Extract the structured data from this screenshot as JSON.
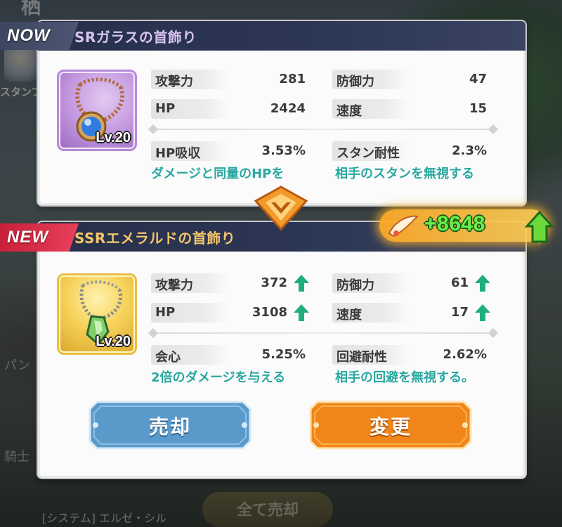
{
  "background": {
    "top_label": "栖",
    "stamp_label": "スタンプ",
    "pan_label": "パン",
    "knight_label": "騎士",
    "system_label": "[システム] エルゼ・シル",
    "sell_all_label": "全て売却"
  },
  "now": {
    "tag": "NOW",
    "title": "SRガラスの首飾り",
    "level": "Lv.20",
    "icon": "necklace-sapphire-icon",
    "stats": [
      {
        "name": "攻撃力",
        "value": "281"
      },
      {
        "name": "防御力",
        "value": "47"
      },
      {
        "name": "HP",
        "value": "2424"
      },
      {
        "name": "速度",
        "value": "15"
      }
    ],
    "sub_stats": [
      {
        "name": "HP吸収",
        "value": "3.53%",
        "desc": "ダメージと同量のHPを"
      },
      {
        "name": "スタン耐性",
        "value": "2.3%",
        "desc": "相手のスタンを無視する"
      }
    ]
  },
  "new": {
    "tag": "NEW",
    "title": "SSRエメラルドの首飾り",
    "level": "Lv.20",
    "icon": "necklace-emerald-icon",
    "stats": [
      {
        "name": "攻撃力",
        "value": "372"
      },
      {
        "name": "防御力",
        "value": "61"
      },
      {
        "name": "HP",
        "value": "3108"
      },
      {
        "name": "速度",
        "value": "17"
      }
    ],
    "sub_stats": [
      {
        "name": "会心",
        "value": "5.25%",
        "desc": "2倍のダメージを与える"
      },
      {
        "name": "回避耐性",
        "value": "2.62%",
        "desc": "相手の回避を無視する。"
      }
    ]
  },
  "power_change": "+8648",
  "buttons": {
    "sell": "売却",
    "change": "変更"
  },
  "colors": {
    "stat_up_arrow": "#1fae7a",
    "desc_text": "#2aa8a0",
    "sell_button": "#4a8fc0",
    "change_button": "#f08a1c"
  }
}
